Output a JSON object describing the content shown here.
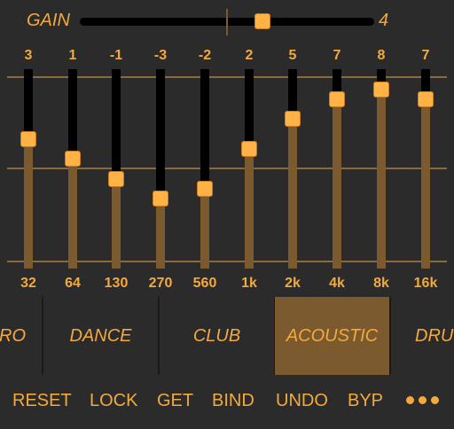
{
  "gain": {
    "label": "GAIN",
    "value": "4",
    "level": 0.62
  },
  "eq": {
    "min": -10,
    "max": 10,
    "bands": [
      {
        "value": "3",
        "freq": "32",
        "level": 3
      },
      {
        "value": "1",
        "freq": "64",
        "level": 1
      },
      {
        "value": "-1",
        "freq": "130",
        "level": -1
      },
      {
        "value": "-3",
        "freq": "270",
        "level": -3
      },
      {
        "value": "-2",
        "freq": "560",
        "level": -2
      },
      {
        "value": "2",
        "freq": "1k",
        "level": 2
      },
      {
        "value": "5",
        "freq": "2k",
        "level": 5
      },
      {
        "value": "7",
        "freq": "4k",
        "level": 7
      },
      {
        "value": "8",
        "freq": "8k",
        "level": 8
      },
      {
        "value": "7",
        "freq": "16k",
        "level": 7
      }
    ]
  },
  "presets": [
    {
      "label": "RO",
      "active": false
    },
    {
      "label": "DANCE",
      "active": false
    },
    {
      "label": "CLUB",
      "active": false
    },
    {
      "label": "ACOUSTIC",
      "active": true
    },
    {
      "label": "DRU",
      "active": false
    }
  ],
  "actions": [
    "RESET",
    "LOCK",
    "GET",
    "BIND",
    "UNDO",
    "BYP"
  ],
  "colors": {
    "accent": "#f4a93c",
    "thumb": "#ffb347",
    "active_preset": "#7a5a2e",
    "background": "#2b2b2b"
  },
  "icons": {
    "more": "more-dots-icon"
  }
}
